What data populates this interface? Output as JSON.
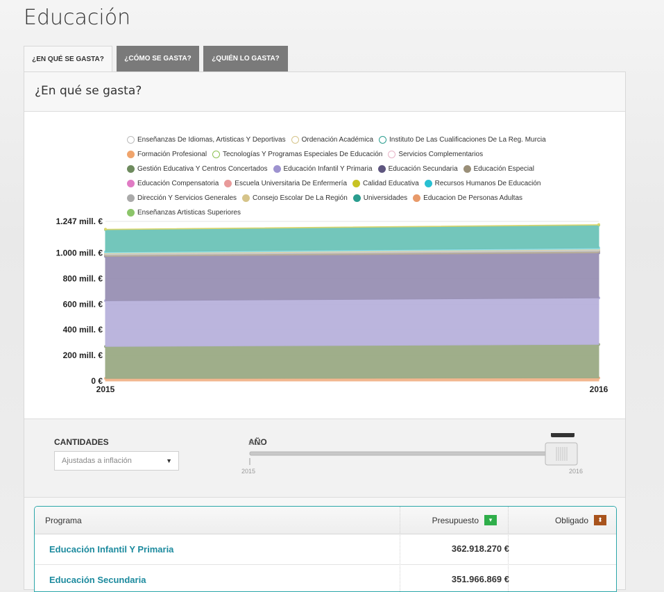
{
  "page": {
    "title": "Educación"
  },
  "tabs": [
    {
      "label": "¿EN QUÉ SE GASTA?"
    },
    {
      "label": "¿CÓMO SE GASTA?"
    },
    {
      "label": "¿QUIÉN LO GASTA?"
    }
  ],
  "panel": {
    "title": "¿En qué se gasta?"
  },
  "legend_rows": [
    [
      {
        "label": "Enseñanzas De Idiomas, Artisticas Y Deportivas",
        "color": "#bbbbbb",
        "hollow": true
      },
      {
        "label": "Ordenación Académica",
        "color": "#d6c48a",
        "hollow": true
      },
      {
        "label": "Instituto De Las Cualificaciones De La Reg. Murcia",
        "color": "#2a9d8f",
        "hollow": true
      }
    ],
    [
      {
        "label": "Formación Profesional",
        "color": "#f0a46c",
        "hollow": false
      },
      {
        "label": "Tecnologías Y Programas Especiales De Educación",
        "color": "#8cc152",
        "hollow": true
      },
      {
        "label": "Servicios Complementarios",
        "color": "#e8b4c8",
        "hollow": true
      }
    ],
    [
      {
        "label": "Gestión Educativa Y Centros Concertados",
        "color": "#6e8b5e",
        "hollow": false
      },
      {
        "label": "Educación Infantil Y Primaria",
        "color": "#9e93d0",
        "hollow": false
      },
      {
        "label": "Educación Secundaria",
        "color": "#5e567f",
        "hollow": false
      },
      {
        "label": "Educación Especial",
        "color": "#9a8f78",
        "hollow": false
      }
    ],
    [
      {
        "label": "Educación Compensatoria",
        "color": "#e07bc4",
        "hollow": false
      },
      {
        "label": "Escuela Universitaria De Enfermería",
        "color": "#e89a9a",
        "hollow": false
      },
      {
        "label": "Calidad Educativa",
        "color": "#c8c324",
        "hollow": false
      },
      {
        "label": "Recursos Humanos De Educación",
        "color": "#28c0d2",
        "hollow": false
      }
    ],
    [
      {
        "label": "Dirección Y Servicios Generales",
        "color": "#aaaaaa",
        "hollow": false
      },
      {
        "label": "Consejo Escolar De La Región",
        "color": "#d6c48a",
        "hollow": false
      },
      {
        "label": "Universidades",
        "color": "#2a9d8f",
        "hollow": false
      },
      {
        "label": "Educacion De Personas Adultas",
        "color": "#e89a6a",
        "hollow": false
      }
    ],
    [
      {
        "label": "Enseñanzas Artisticas Superiores",
        "color": "#8cc56a",
        "hollow": false
      }
    ]
  ],
  "chart_data": {
    "type": "area",
    "stacked": true,
    "x": [
      2015,
      2016
    ],
    "x_tick_labels": [
      "2015",
      "2016"
    ],
    "y_tick_labels": [
      "0 €",
      "200 mill. €",
      "400 mill. €",
      "600 mill. €",
      "800 mill. €",
      "1.000 mill. €",
      "1.247 mill. €"
    ],
    "y_ticks": [
      0,
      200,
      400,
      600,
      800,
      1000,
      1247
    ],
    "ylim": [
      0,
      1247
    ],
    "y_unit": "mill. €",
    "series": [
      {
        "name": "Educacion De Personas Adultas",
        "color": "#f2b48a",
        "values": [
          20,
          24
        ]
      },
      {
        "name": "Gestión Educativa Y Centros Concertados",
        "color": "#9aaa84",
        "values": [
          250,
          262
        ]
      },
      {
        "name": "Educación Infantil Y Primaria",
        "color": "#b8b2dc",
        "values": [
          357,
          363
        ]
      },
      {
        "name": "Educación Secundaria",
        "color": "#9890b4",
        "values": [
          346,
          352
        ]
      },
      {
        "name": "Educación Especial",
        "color": "#b5ab98",
        "values": [
          12,
          13
        ]
      },
      {
        "name": "Dirección Y Servicios Generales",
        "color": "#c8c8c8",
        "values": [
          10,
          11
        ]
      },
      {
        "name": "Consejo Escolar De La Región",
        "color": "#e3d7aa",
        "values": [
          6,
          6
        ]
      },
      {
        "name": "Recursos Humanos De Educación",
        "color": "#8edce6",
        "values": [
          8,
          9
        ]
      },
      {
        "name": "Universidades",
        "color": "#6cc3b8",
        "values": [
          173,
          178
        ]
      },
      {
        "name": "Calidad Educativa",
        "color": "#d9d56a",
        "values": [
          4,
          4
        ]
      }
    ]
  },
  "controls": {
    "cantidades_label": "CANTIDADES",
    "cantidades_value": "Ajustadas a inflación",
    "anio_label": "AÑO",
    "slider_min_top": "2015",
    "slider_min_bottom": "2015",
    "slider_max_bottom": "2016",
    "slider_current": "2016",
    "slider_fraction": 1.0
  },
  "table": {
    "headers": {
      "programa": "Programa",
      "presupuesto": "Presupuesto",
      "obligado": "Obligado"
    },
    "sort_colors": {
      "presupuesto": "#2fae4a",
      "obligado": "#a8531c"
    },
    "rows": [
      {
        "programa": "Educación Infantil Y Primaria",
        "presupuesto": "362.918.270 €",
        "obligado": ""
      },
      {
        "programa": "Educación Secundaria",
        "presupuesto": "351.966.869 €",
        "obligado": ""
      }
    ]
  }
}
